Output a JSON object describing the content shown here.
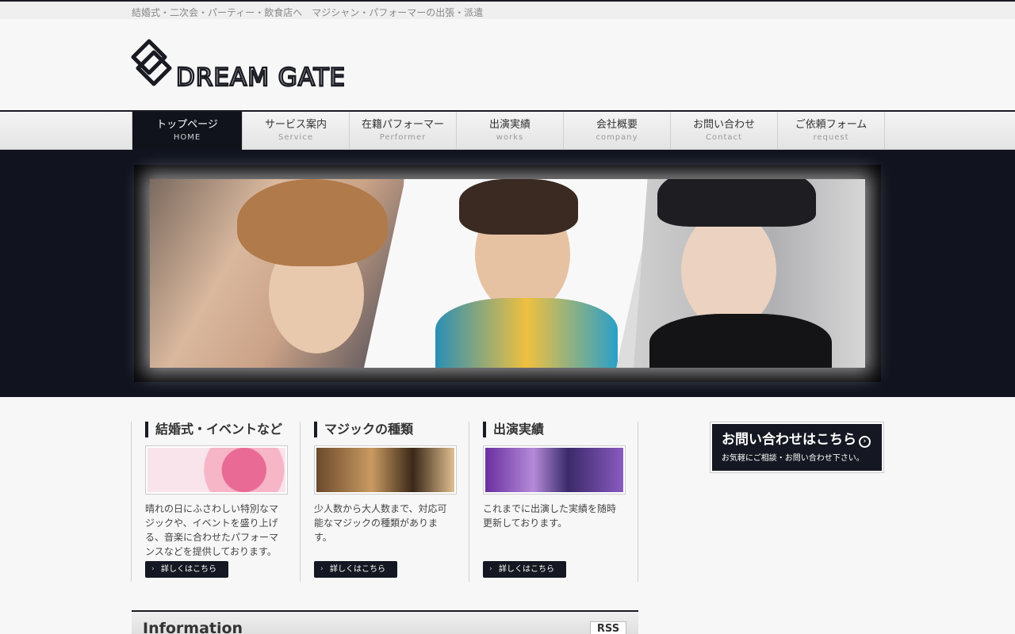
{
  "header": {
    "tagline": "結婚式・二次会・パーティー・飲食店へ　マジシャン・パフォーマーの出張・派遣",
    "logo_text": "DREAM GATE"
  },
  "nav": [
    {
      "jp": "トップページ",
      "en": "HOME",
      "active": true
    },
    {
      "jp": "サービス案内",
      "en": "Service"
    },
    {
      "jp": "在籍パフォーマー",
      "en": "Performer"
    },
    {
      "jp": "出演実績",
      "en": "works"
    },
    {
      "jp": "会社概要",
      "en": "company"
    },
    {
      "jp": "お問い合わせ",
      "en": "Contact"
    },
    {
      "jp": "ご依頼フォーム",
      "en": "request"
    }
  ],
  "columns": [
    {
      "title": "結婚式・イベントなど",
      "text": "晴れの日にふさわしい特別なマジックや、イベントを盛り上げる、音楽に合わせたパフォーマンスなどを提供しております。",
      "button": "詳しくはこちら"
    },
    {
      "title": "マジックの種類",
      "text": "少人数から大人数まで、対応可能なマジックの種類があります。",
      "button": "詳しくはこちら"
    },
    {
      "title": "出演実績",
      "text": "これまでに出演した実績を随時更新しております。",
      "button": "詳しくはこちら"
    }
  ],
  "contact": {
    "main": "お問い合わせはこちら",
    "sub": "お気軽にご相談・お問い合わせ下さい。"
  },
  "info": {
    "title": "Information",
    "rss": "RSS"
  },
  "colors": {
    "dark": "#11131c",
    "accent": "#1a1a22"
  }
}
